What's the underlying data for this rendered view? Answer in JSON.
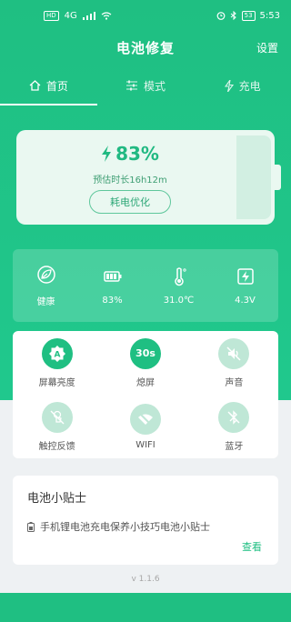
{
  "statusbar": {
    "left_chip": "HD",
    "network": "4G",
    "battery_level": "53",
    "time": "5:53"
  },
  "header": {
    "title": "电池修复",
    "settings_label": "设置"
  },
  "tabs": [
    {
      "label": "首页"
    },
    {
      "label": "模式"
    },
    {
      "label": "充电"
    }
  ],
  "battery": {
    "percent_text": "83%",
    "estimate_text": "预估时长16h12m",
    "optimize_button": "耗电优化",
    "level": 0.83
  },
  "stats": [
    {
      "label": "健康",
      "icon": "leaf-icon"
    },
    {
      "label": "83%",
      "icon": "battery-icon"
    },
    {
      "label": "31.0℃",
      "icon": "thermometer-icon"
    },
    {
      "label": "4.3V",
      "icon": "voltage-icon"
    }
  ],
  "quick_settings": [
    {
      "label": "屏幕亮度",
      "icon_text": "A",
      "icon": "brightness-icon",
      "active": true
    },
    {
      "label": "熄屏",
      "icon_text": "30s",
      "icon": "screen-timeout-icon",
      "active": true
    },
    {
      "label": "声音",
      "icon_text": "",
      "icon": "sound-off-icon",
      "active": false
    },
    {
      "label": "触控反馈",
      "icon_text": "",
      "icon": "touch-feedback-icon",
      "active": false
    },
    {
      "label": "WIFI",
      "icon_text": "",
      "icon": "wifi-off-icon",
      "active": false
    },
    {
      "label": "蓝牙",
      "icon_text": "",
      "icon": "bluetooth-off-icon",
      "active": false
    }
  ],
  "tips": {
    "title": "电池小贴士",
    "line": "手机锂电池充电保养小技巧电池小贴士",
    "more": "查看"
  },
  "version": "v 1.1.6",
  "colors": {
    "primary": "#1fbf82",
    "accent_text": "#21b982"
  }
}
